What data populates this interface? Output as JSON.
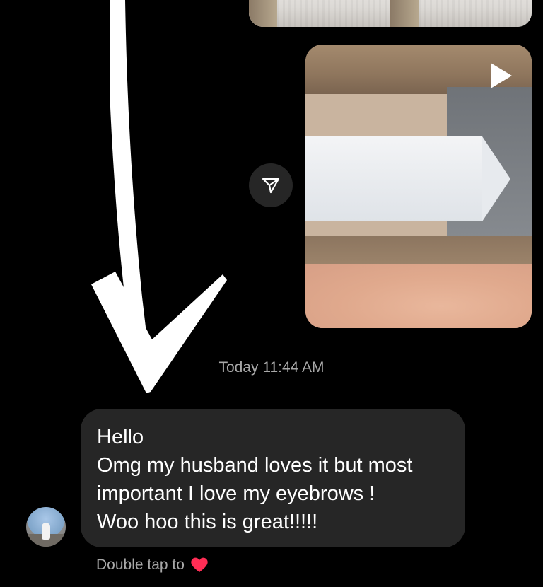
{
  "thread": {
    "timestamp": "Today 11:44 AM",
    "message_lines": [
      "Hello",
      "Omg my husband loves it but most",
      "important I love my eyebrows !",
      "Woo hoo this is great!!!!!"
    ],
    "double_tap_label": "Double tap to"
  },
  "icons": {
    "share": "paper-plane-icon",
    "play": "play-icon",
    "heart": "heart-icon"
  },
  "colors": {
    "background": "#000000",
    "bubble": "#262626",
    "secondary_text": "#a8a8a8",
    "heart": "#ff2d55"
  }
}
